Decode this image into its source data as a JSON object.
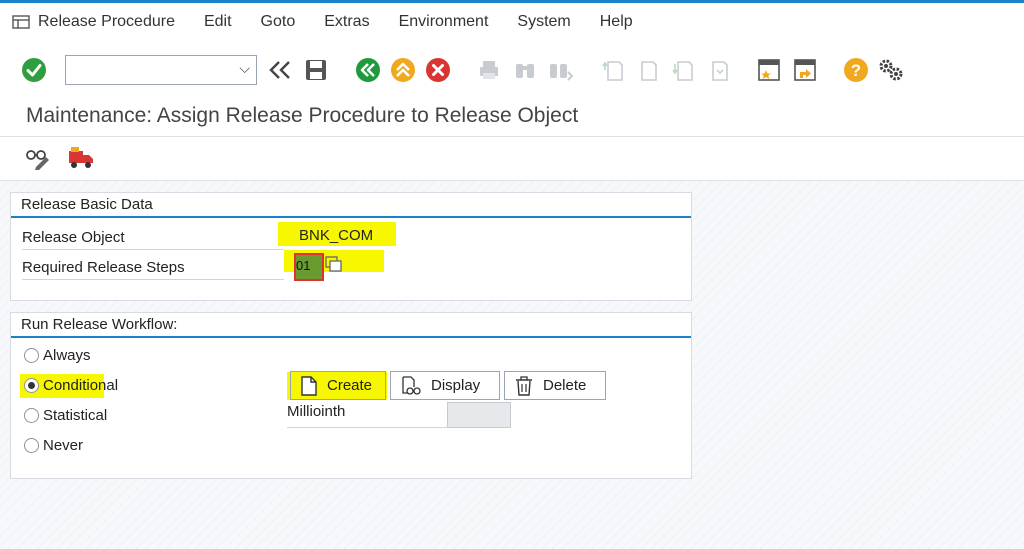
{
  "menu": {
    "items": [
      "Release Procedure",
      "Edit",
      "Goto",
      "Extras",
      "Environment",
      "System",
      "Help"
    ]
  },
  "toolbar": {
    "command_field_value": ""
  },
  "page": {
    "title": "Maintenance: Assign Release Procedure to Release Object"
  },
  "basic_data": {
    "title": "Release Basic Data",
    "release_object_label": "Release Object",
    "release_object_value": "BNK_COM",
    "required_steps_label": "Required Release Steps",
    "required_steps_value": "01"
  },
  "workflow": {
    "title": "Run Release Workflow:",
    "options": [
      "Always",
      "Conditional",
      "Statistical",
      "Never"
    ],
    "selected": "Conditional",
    "create_label": "Create",
    "display_label": "Display",
    "delete_label": "Delete",
    "millio_label": "Milliointh"
  },
  "colors": {
    "accent": "#1a82c8",
    "highlight": "#f7f700",
    "check_green": "#2e9e3e",
    "back_green": "#1f9a3c",
    "exit_orange": "#f0a91e",
    "cancel_red": "#d93535",
    "help_orange": "#f0a91e"
  }
}
